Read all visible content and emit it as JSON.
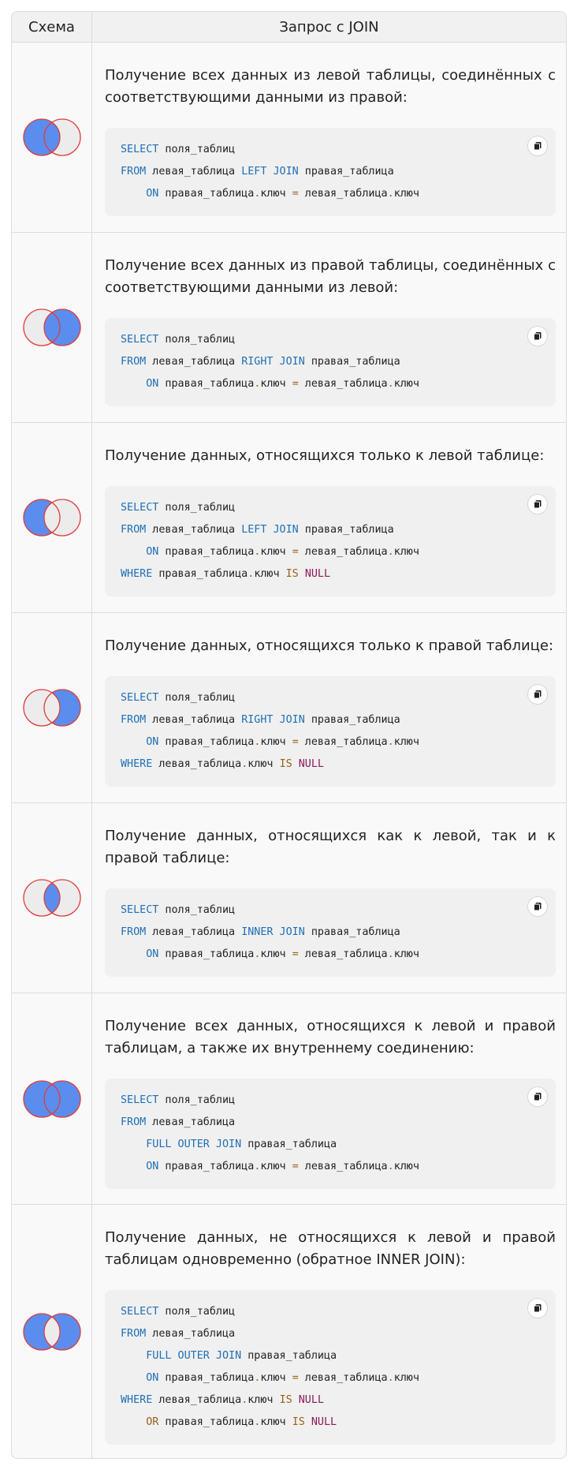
{
  "header": {
    "scheme": "Схема",
    "query": "Запрос с JOIN"
  },
  "colors": {
    "venn_fill": "#5b8def",
    "venn_stroke": "#e03c3c",
    "venn_empty": "#ececec",
    "keyword": "#1f6fb5",
    "operator": "#9c5f1a",
    "null": "#8a1c5a"
  },
  "rows": [
    {
      "venn": "left",
      "description": "Получение всех данных из левой таблицы, соединённых с соответствующими данными из правой:",
      "code": [
        [
          [
            "k",
            "SELECT"
          ],
          [
            "t",
            " поля_таблиц"
          ]
        ],
        [
          [
            "k",
            "FROM"
          ],
          [
            "t",
            " левая_таблица "
          ],
          [
            "k",
            "LEFT JOIN"
          ],
          [
            "t",
            " правая_таблица"
          ]
        ],
        [
          [
            "t",
            "    "
          ],
          [
            "k",
            "ON"
          ],
          [
            "t",
            " правая_таблица"
          ],
          [
            "o",
            "."
          ],
          [
            "t",
            "ключ "
          ],
          [
            "o",
            "="
          ],
          [
            "t",
            " левая_таблица"
          ],
          [
            "o",
            "."
          ],
          [
            "t",
            "ключ"
          ]
        ]
      ]
    },
    {
      "venn": "right",
      "description": "Получение всех данных из правой таблицы, соединённых с соответствующими данными из левой:",
      "code": [
        [
          [
            "k",
            "SELECT"
          ],
          [
            "t",
            " поля_таблиц"
          ]
        ],
        [
          [
            "k",
            "FROM"
          ],
          [
            "t",
            " левая_таблица "
          ],
          [
            "k",
            "RIGHT JOIN"
          ],
          [
            "t",
            " правая_таблица"
          ]
        ],
        [
          [
            "t",
            "    "
          ],
          [
            "k",
            "ON"
          ],
          [
            "t",
            " правая_таблица"
          ],
          [
            "o",
            "."
          ],
          [
            "t",
            "ключ "
          ],
          [
            "o",
            "="
          ],
          [
            "t",
            " левая_таблица"
          ],
          [
            "o",
            "."
          ],
          [
            "t",
            "ключ"
          ]
        ]
      ]
    },
    {
      "venn": "left-only",
      "description": "Получение данных, относящихся только к левой таблице:",
      "code": [
        [
          [
            "k",
            "SELECT"
          ],
          [
            "t",
            " поля_таблиц"
          ]
        ],
        [
          [
            "k",
            "FROM"
          ],
          [
            "t",
            " левая_таблица "
          ],
          [
            "k",
            "LEFT JOIN"
          ],
          [
            "t",
            " правая_таблица"
          ]
        ],
        [
          [
            "t",
            "    "
          ],
          [
            "k",
            "ON"
          ],
          [
            "t",
            " правая_таблица"
          ],
          [
            "o",
            "."
          ],
          [
            "t",
            "ключ "
          ],
          [
            "o",
            "="
          ],
          [
            "t",
            " левая_таблица"
          ],
          [
            "o",
            "."
          ],
          [
            "t",
            "ключ"
          ]
        ],
        [
          [
            "k",
            "WHERE"
          ],
          [
            "t",
            " правая_таблица"
          ],
          [
            "o",
            "."
          ],
          [
            "t",
            "ключ "
          ],
          [
            "o",
            "IS"
          ],
          [
            "t",
            " "
          ],
          [
            "n",
            "NULL"
          ]
        ]
      ]
    },
    {
      "venn": "right-only",
      "description": "Получение данных, относящихся только к правой таблице:",
      "code": [
        [
          [
            "k",
            "SELECT"
          ],
          [
            "t",
            " поля_таблиц"
          ]
        ],
        [
          [
            "k",
            "FROM"
          ],
          [
            "t",
            " левая_таблица "
          ],
          [
            "k",
            "RIGHT JOIN"
          ],
          [
            "t",
            " правая_таблица"
          ]
        ],
        [
          [
            "t",
            "    "
          ],
          [
            "k",
            "ON"
          ],
          [
            "t",
            " правая_таблица"
          ],
          [
            "o",
            "."
          ],
          [
            "t",
            "ключ "
          ],
          [
            "o",
            "="
          ],
          [
            "t",
            " левая_таблица"
          ],
          [
            "o",
            "."
          ],
          [
            "t",
            "ключ"
          ]
        ],
        [
          [
            "k",
            "WHERE"
          ],
          [
            "t",
            " левая_таблица"
          ],
          [
            "o",
            "."
          ],
          [
            "t",
            "ключ "
          ],
          [
            "o",
            "IS"
          ],
          [
            "t",
            " "
          ],
          [
            "n",
            "NULL"
          ]
        ]
      ]
    },
    {
      "venn": "inner",
      "description": "Получение данных, относящихся как к левой, так и к правой таблице:",
      "code": [
        [
          [
            "k",
            "SELECT"
          ],
          [
            "t",
            " поля_таблиц"
          ]
        ],
        [
          [
            "k",
            "FROM"
          ],
          [
            "t",
            " левая_таблица "
          ],
          [
            "k",
            "INNER JOIN"
          ],
          [
            "t",
            " правая_таблица"
          ]
        ],
        [
          [
            "t",
            "    "
          ],
          [
            "k",
            "ON"
          ],
          [
            "t",
            " правая_таблица"
          ],
          [
            "o",
            "."
          ],
          [
            "t",
            "ключ "
          ],
          [
            "o",
            "="
          ],
          [
            "t",
            " левая_таблица"
          ],
          [
            "o",
            "."
          ],
          [
            "t",
            "ключ"
          ]
        ]
      ]
    },
    {
      "venn": "full",
      "description": "Получение всех данных, относящихся к левой и правой таблицам, а также их внутреннему соединению:",
      "code": [
        [
          [
            "k",
            "SELECT"
          ],
          [
            "t",
            " поля_таблиц"
          ]
        ],
        [
          [
            "k",
            "FROM"
          ],
          [
            "t",
            " левая_таблица"
          ]
        ],
        [
          [
            "t",
            "    "
          ],
          [
            "k",
            "FULL OUTER JOIN"
          ],
          [
            "t",
            " правая_таблица"
          ]
        ],
        [
          [
            "t",
            "    "
          ],
          [
            "k",
            "ON"
          ],
          [
            "t",
            " правая_таблица"
          ],
          [
            "o",
            "."
          ],
          [
            "t",
            "ключ "
          ],
          [
            "o",
            "="
          ],
          [
            "t",
            " левая_таблица"
          ],
          [
            "o",
            "."
          ],
          [
            "t",
            "ключ"
          ]
        ]
      ]
    },
    {
      "venn": "outer-excluding",
      "description": "Получение данных, не относящихся к левой и правой таблицам одновременно (обратное INNER JOIN):",
      "code": [
        [
          [
            "k",
            "SELECT"
          ],
          [
            "t",
            " поля_таблиц"
          ]
        ],
        [
          [
            "k",
            "FROM"
          ],
          [
            "t",
            " левая_таблица"
          ]
        ],
        [
          [
            "t",
            "    "
          ],
          [
            "k",
            "FULL OUTER JOIN"
          ],
          [
            "t",
            " правая_таблица"
          ]
        ],
        [
          [
            "t",
            "    "
          ],
          [
            "k",
            "ON"
          ],
          [
            "t",
            " правая_таблица"
          ],
          [
            "o",
            "."
          ],
          [
            "t",
            "ключ "
          ],
          [
            "o",
            "="
          ],
          [
            "t",
            " левая_таблица"
          ],
          [
            "o",
            "."
          ],
          [
            "t",
            "ключ"
          ]
        ],
        [
          [
            "k",
            "WHERE"
          ],
          [
            "t",
            " левая_таблица"
          ],
          [
            "o",
            "."
          ],
          [
            "t",
            "ключ "
          ],
          [
            "o",
            "IS"
          ],
          [
            "t",
            " "
          ],
          [
            "n",
            "NULL"
          ]
        ],
        [
          [
            "t",
            "    "
          ],
          [
            "o",
            "OR"
          ],
          [
            "t",
            " правая_таблица"
          ],
          [
            "o",
            "."
          ],
          [
            "t",
            "ключ "
          ],
          [
            "o",
            "IS"
          ],
          [
            "t",
            " "
          ],
          [
            "n",
            "NULL"
          ]
        ]
      ]
    }
  ]
}
